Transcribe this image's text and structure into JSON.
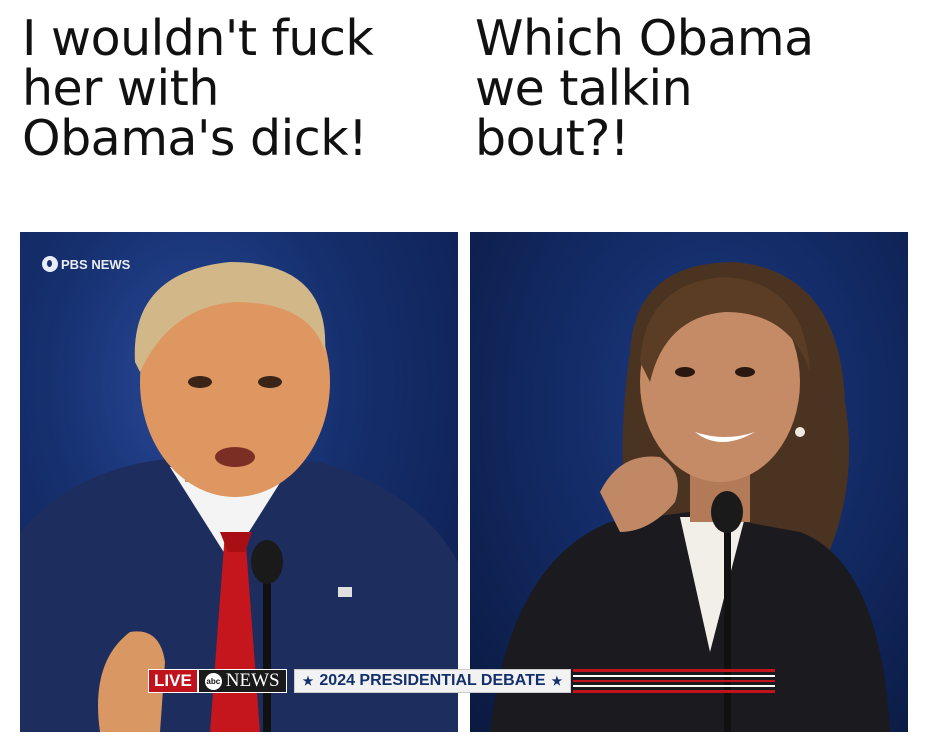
{
  "captions": {
    "left": "I wouldn't fuck\nher with\nObama's dick!",
    "right": "Which Obama\nwe talkin\nbout?!"
  },
  "watermark": {
    "text": "PBS NEWS"
  },
  "ticker": {
    "live": "LIVE",
    "network_logo": "abc",
    "network": "NEWS",
    "title": "2024 PRESIDENTIAL DEBATE",
    "star": "★"
  },
  "colors": {
    "background_blue": "#16306f",
    "ticker_red": "#c1131b",
    "ticker_navy": "#12306b"
  }
}
